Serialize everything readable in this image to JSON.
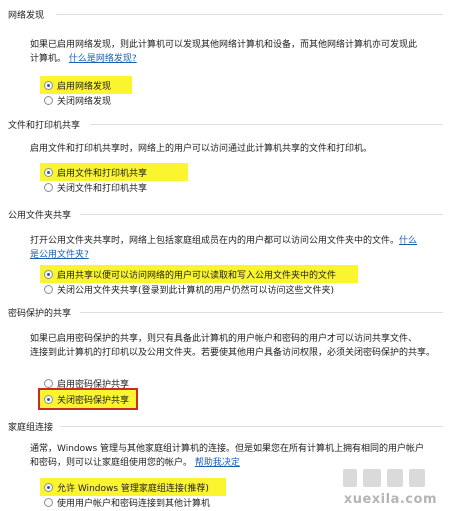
{
  "sections": [
    {
      "header": "网络发现",
      "desc_lines": [
        "如果已启用网络发现，则此计算机可以发现其他网络计算机和设备，而其他网络计算机亦可发现此",
        "计算机。"
      ],
      "link": "什么是网络发现?",
      "options": [
        {
          "label": "启用网络发现",
          "checked": true
        },
        {
          "label": "关闭网络发现",
          "checked": false
        }
      ]
    },
    {
      "header": "文件和打印机共享",
      "desc_lines": [
        "启用文件和打印机共享时，网络上的用户可以访问通过此计算机共享的文件和打印机。"
      ],
      "options": [
        {
          "label": "启用文件和打印机共享",
          "checked": true
        },
        {
          "label": "关闭文件和打印机共享",
          "checked": false
        }
      ]
    },
    {
      "header": "公用文件夹共享",
      "desc_lines": [
        "打开公用文件夹共享时，网络上包括家庭组成员在内的用户都可以访问公用文件夹中的文件。",
        "公用文件夹?"
      ],
      "link": "什么",
      "link_tail": "是",
      "options": [
        {
          "label": "启用共享以便可以访问网络的用户可以读取和写入公用文件夹中的文件",
          "checked": true
        },
        {
          "label": "关闭公用文件夹共享(登录到此计算机的用户仍然可以访问这些文件夹)",
          "checked": false
        }
      ]
    },
    {
      "header": "密码保护的共享",
      "desc_lines": [
        "如果已启用密码保护的共享，则只有具备此计算机的用户帐户和密码的用户才可以访问共享文件、",
        "连接到此计算机的打印机以及公用文件夹。若要使其他用户具备访问权限，必须关闭密码保护的共享。"
      ],
      "options": [
        {
          "label": "启用密码保护共享",
          "checked": false
        },
        {
          "label": "关闭密码保护共享",
          "checked": true
        }
      ]
    },
    {
      "header": "家庭组连接",
      "desc_lines": [
        "通常，Windows 管理与其他家庭组计算机的连接。但是如果您在所有计算机上拥有相同的用户帐户",
        "和密码，则可以让家庭组使用您的帐户。"
      ],
      "link": "帮助我决定",
      "options": [
        {
          "label": "允许 Windows 管理家庭组连接(推荐)",
          "checked": true
        },
        {
          "label": "使用用户帐户和密码连接到其他计算机",
          "checked": false
        }
      ]
    }
  ],
  "watermark": "xuexila.com",
  "colors": {
    "highlight": "#fbf530",
    "red_box": "#c62d25",
    "link": "#1a5fb4",
    "divider": "#d8dde6"
  }
}
